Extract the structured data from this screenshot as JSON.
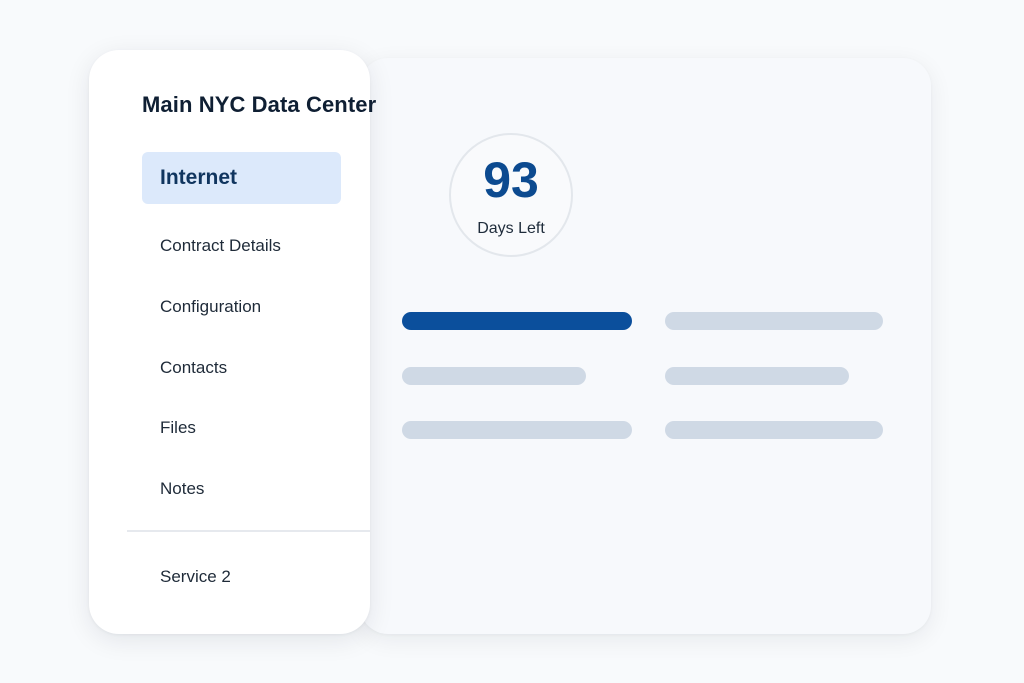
{
  "sidebar": {
    "title": "Main NYC Data Center",
    "items": [
      {
        "label": "Internet",
        "active": true
      },
      {
        "label": "Contract Details"
      },
      {
        "label": "Configuration"
      },
      {
        "label": "Contacts"
      },
      {
        "label": "Files"
      },
      {
        "label": "Notes"
      }
    ],
    "footer_item": {
      "label": "Service 2"
    }
  },
  "countdown": {
    "value": "93",
    "label": "Days Left"
  },
  "colors": {
    "accent": "#0b4f9c",
    "active_nav_bg": "#dce9fb",
    "placeholder_bar": "#cfd9e5"
  }
}
